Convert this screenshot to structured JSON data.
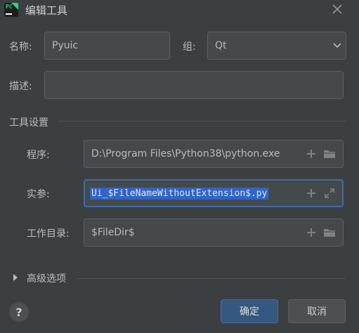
{
  "window": {
    "title": "编辑工具",
    "close_icon": "close-icon"
  },
  "form": {
    "name_label": "名称:",
    "name_value": "Pyuic",
    "group_label": "组:",
    "group_value": "Qt",
    "desc_label": "描述:",
    "desc_value": ""
  },
  "tool_settings": {
    "section_title": "工具设置",
    "program_label": "程序:",
    "program_value": "D:\\Program Files\\Python38\\python.exe",
    "args_label": "实参:",
    "args_value": "Ui_$FileNameWithoutExtension$.py",
    "workdir_label": "工作目录:",
    "workdir_value": "$FileDir$"
  },
  "advanced": {
    "label": "高级选项"
  },
  "buttons": {
    "ok": "确定",
    "cancel": "取消",
    "help": "?"
  },
  "colors": {
    "accent": "#365880",
    "selection": "#2f65ca",
    "focus_border": "#3d6ba6",
    "background": "#3c3f41"
  }
}
